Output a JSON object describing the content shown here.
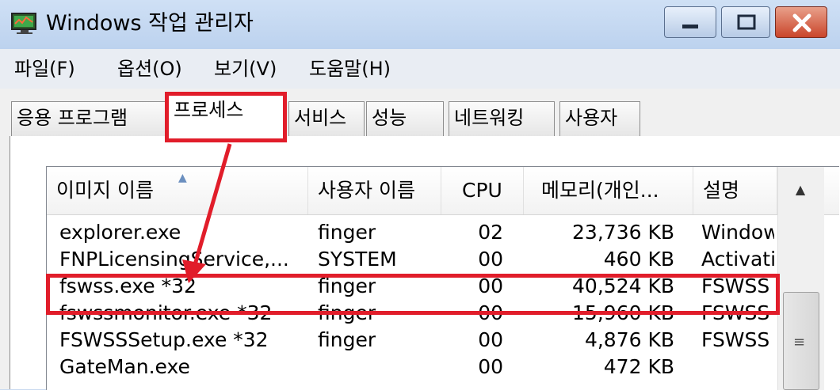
{
  "window": {
    "title": "Windows 작업 관리자",
    "icon": "monitor-icon",
    "buttons": [
      "minimize-icon",
      "maximize-icon",
      "close-icon"
    ]
  },
  "menu": [
    "파일(F)",
    "옵션(O)",
    "보기(V)",
    "도움말(H)"
  ],
  "tabs": [
    {
      "label": "응용 프로그램",
      "active": false
    },
    {
      "label": "프로세스",
      "active": true
    },
    {
      "label": "서비스",
      "active": false
    },
    {
      "label": "성능",
      "active": false
    },
    {
      "label": "네트워킹",
      "active": false
    },
    {
      "label": "사용자",
      "active": false
    }
  ],
  "columns": [
    "이미지 이름",
    "사용자 이름",
    "CPU",
    "메모리(개인...",
    "설명"
  ],
  "rows": [
    {
      "name": "explorer.exe",
      "user": "finger",
      "cpu": "02",
      "mem": "23,736 KB",
      "desc": "Window"
    },
    {
      "name": "FNPLicensingService,...",
      "user": "SYSTEM",
      "cpu": "00",
      "mem": "460 KB",
      "desc": "Activati"
    },
    {
      "name": "fswss.exe *32",
      "user": "finger",
      "cpu": "00",
      "mem": "40,524 KB",
      "desc": "FSWSS"
    },
    {
      "name": "fswssmonitor.exe *32",
      "user": "finger",
      "cpu": "00",
      "mem": "15,960 KB",
      "desc": "FSWSS"
    },
    {
      "name": "FSWSSSetup.exe *32",
      "user": "finger",
      "cpu": "00",
      "mem": "4,876 KB",
      "desc": "FSWSS"
    },
    {
      "name": "GateMan.exe",
      "user": "",
      "cpu": "00",
      "mem": "472 KB",
      "desc": ""
    }
  ],
  "scrollbar": {
    "up_arrow": "▲",
    "grip": "≡"
  },
  "colors": {
    "highlight": "#e11d2a"
  }
}
